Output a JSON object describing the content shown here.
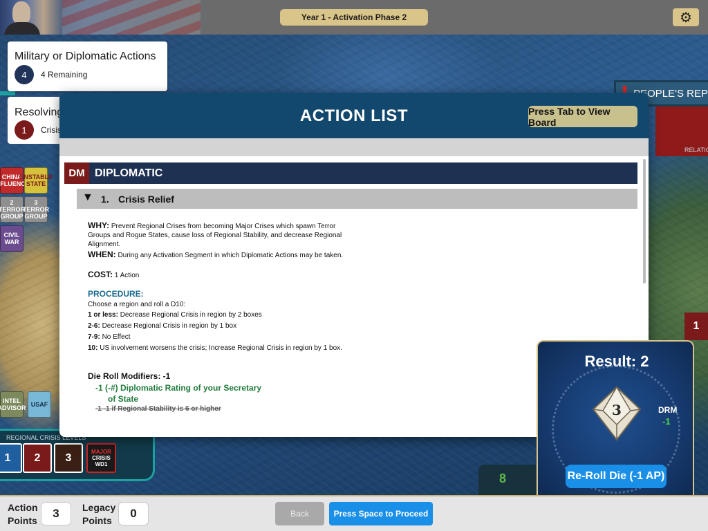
{
  "topbar": {
    "phase": "Year 1  -  Activation Phase 2",
    "settings_icon": "gear-icon"
  },
  "left_panel": {
    "actions_title": "Military or Diplomatic Actions",
    "actions_count": "4",
    "actions_remaining": "4 Remaining",
    "resolving_title": "Resolving",
    "resolving_count": "1",
    "resolving_sub": "Crisis"
  },
  "counters": {
    "china": "CHINA\nINFLUENCE",
    "unstable": "UNSTABLE\nSTATE",
    "terror1": "2\nTERROR\nGROUP",
    "terror2": "3\nTERROR\nGROUP",
    "civil": "CIVIL\nWAR",
    "intel": "INTEL\nADVISOR",
    "usaf": "USAF"
  },
  "crisis_levels": {
    "label": "REGIONAL CRISIS LEVELS",
    "levels": [
      "1",
      "2",
      "3"
    ],
    "major_line1": "MAJOR",
    "major_line2": "CRISIS",
    "major_line3": "WD1"
  },
  "right_map": {
    "prc_title": "PEOPLE'S REP",
    "relation": "RELATION",
    "chip_value": "1",
    "green_value": "8"
  },
  "modal": {
    "title": "ACTION LIST",
    "tab_button": "Press Tab to View Board",
    "category_code": "DM",
    "category_name": "DIPLOMATIC",
    "item_number": "1.",
    "item_name": "Crisis Relief",
    "why_label": "WHY:",
    "why_text": "Prevent Regional Crises from becoming Major Crises which spawn Terror Groups and Rogue States, cause loss of Regional Stability, and decrease Regional Alignment.",
    "when_label": "WHEN:",
    "when_text": "During any Activation Segment in which Diplomatic Actions may be taken.",
    "cost_label": "COST:",
    "cost_text": "1 Action",
    "procedure_label": "PROCEDURE:",
    "procedure_intro": "Choose a region and roll a D10:",
    "procedure_rows": [
      {
        "key": "1 or less:",
        "text": "Decrease Regional Crisis in region by 2 boxes"
      },
      {
        "key": "2-6:",
        "text": "Decrease Regional Crisis in region by 1 box"
      },
      {
        "key": "7-9:",
        "text": "No Effect"
      },
      {
        "key": "10:",
        "text": "US involvement worsens the crisis; Increase Regional Crisis in region by 1 box."
      }
    ],
    "drm_heading": "Die Roll Modifiers:   -1",
    "drm_line1": "-1  (-#) Diplomatic Rating of your Secretary",
    "drm_line2": "of State",
    "drm_strike": "-1  -1 if Regional Stability is 6 or higher"
  },
  "die": {
    "result": "Result: 2",
    "face": "3",
    "drm_label": "DRM",
    "drm_value": "-1",
    "reroll": "Re-Roll Die (-1 AP)"
  },
  "bottom": {
    "ap_label_1": "Action",
    "ap_label_2": "Points",
    "ap_value": "3",
    "lp_label_1": "Legacy",
    "lp_label_2": "Points",
    "lp_value": "0",
    "back": "Back",
    "proceed": "Press Space to Proceed"
  }
}
